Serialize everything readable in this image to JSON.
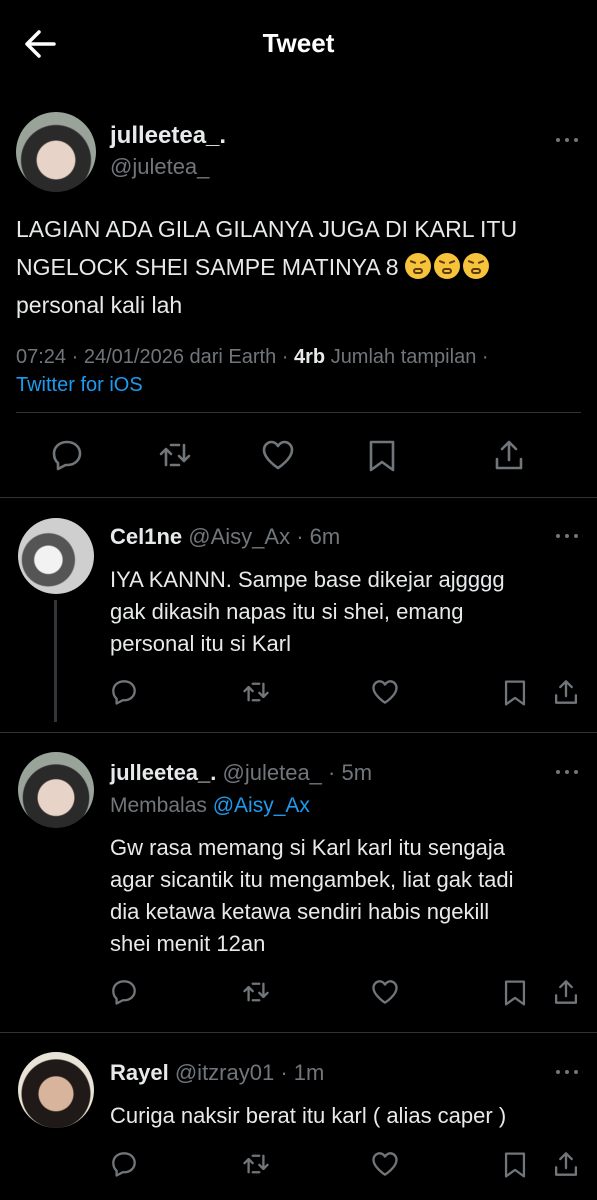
{
  "header": {
    "title": "Tweet"
  },
  "tweet": {
    "display_name": "julleetea_.",
    "handle": "@juletea_",
    "text_line1": "LAGIAN ADA GILA GILANYA JUGA DI KARL ITU",
    "text_line2": "NGELOCK SHEI SAMPE MATINYA 8",
    "text_line3": "personal kali lah",
    "emoji": "tired-face",
    "time": "07:24",
    "date": "24/01/2026 dari Earth",
    "views_count": "4rb",
    "views_label": "Jumlah tampilan",
    "source": "Twitter for iOS"
  },
  "replies": [
    {
      "display_name": "Cel1ne",
      "handle": "@Aisy_Ax",
      "age": "6m",
      "lines": [
        "IYA KANNN. Sampe base dikejar ajgggg",
        "gak dikasih napas itu si shei, emang",
        "personal itu si Karl"
      ]
    },
    {
      "display_name": "julleetea_.",
      "handle": "@juletea_",
      "age": "5m",
      "replying_label": "Membalas",
      "replying_to": "@Aisy_Ax",
      "lines": [
        "Gw rasa memang si Karl karl itu sengaja",
        "agar sicantik itu mengambek, liat gak tadi",
        "dia ketawa ketawa sendiri habis ngekill",
        "shei menit 12an"
      ]
    },
    {
      "display_name": "Rayel",
      "handle": "@itzray01",
      "age": "1m",
      "lines": [
        "Curiga naksir berat itu karl ( alias caper )"
      ]
    }
  ],
  "colors": {
    "background": "#000000",
    "text": "#e7e9ea",
    "muted": "#71767b",
    "link": "#1d9bf0",
    "divider": "#2f3336"
  },
  "icons": [
    "back-arrow-icon",
    "more-icon",
    "reply-icon",
    "retweet-icon",
    "like-icon",
    "bookmark-icon",
    "share-icon"
  ]
}
